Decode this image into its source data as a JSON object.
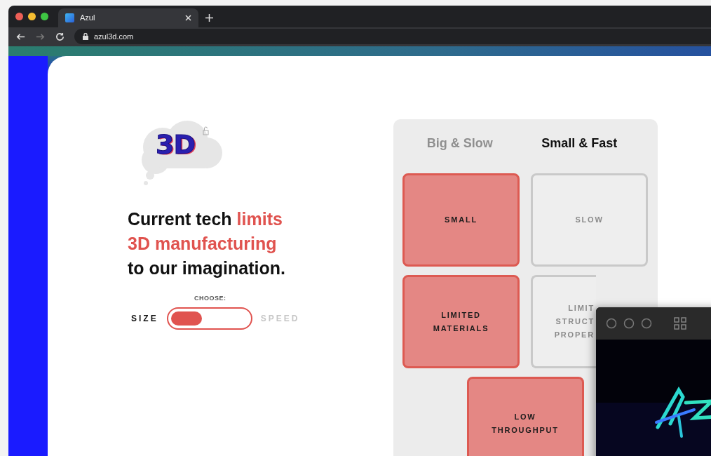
{
  "browser": {
    "tab": {
      "title": "Azul",
      "selected": true
    },
    "nav": [
      {
        "kind": "back",
        "disabled": false
      },
      {
        "kind": "forward",
        "disabled": true
      },
      {
        "kind": "reload",
        "disabled": false
      }
    ],
    "url": "azul3d.com"
  },
  "logo": {
    "text": "3D"
  },
  "headline": [
    {
      "text": "Current tech ",
      "accent": false
    },
    {
      "text": "limits",
      "accent": true
    },
    {
      "text": "3D manufacturing",
      "accent": true,
      "break": true
    },
    {
      "text": "to our imagination.",
      "accent": false,
      "break": true
    }
  ],
  "chooser": {
    "label": "CHOOSE:",
    "options": [
      {
        "label": "SIZE",
        "selected": true
      },
      {
        "label": "SPEED",
        "selected": false
      }
    ]
  },
  "panel": {
    "tabs": [
      {
        "label": "Big & Slow",
        "selected": false
      },
      {
        "label": "Small & Fast",
        "selected": true
      }
    ],
    "cards": [
      {
        "lines": [
          "SMALL"
        ],
        "active": true
      },
      {
        "lines": [
          "SLOW"
        ],
        "active": false
      },
      {
        "lines": [
          "LIMITED",
          "MATERIALS"
        ],
        "active": true
      },
      {
        "lines": [
          "LIMIT",
          "STRUCT",
          "PROPER"
        ],
        "active": false,
        "covered": true
      },
      {
        "lines": [
          "LOW",
          "THROUGHPUT"
        ],
        "active": true
      }
    ]
  }
}
